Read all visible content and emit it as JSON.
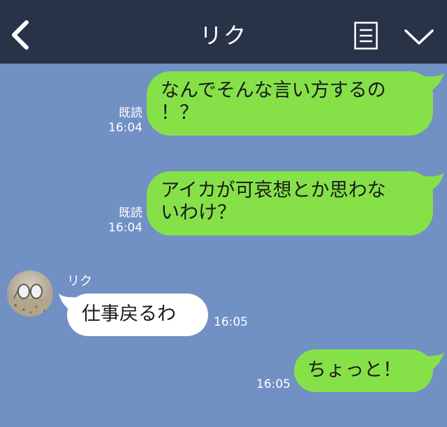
{
  "header": {
    "title": "リク",
    "back_icon": "chevron-left-icon",
    "menu_icon": "menu-list-icon",
    "dropdown_icon": "chevron-down-icon"
  },
  "colors": {
    "header_bg": "#283348",
    "chat_bg": "#7190c4",
    "outgoing_bubble": "#86e149",
    "incoming_bubble": "#ffffff"
  },
  "messages": [
    {
      "direction": "outgoing",
      "lines": [
        "なんでそんな言い方するの",
        "！？"
      ],
      "read": "既読",
      "time": "16:04"
    },
    {
      "direction": "outgoing",
      "lines": [
        "アイカが可哀想とか思わな",
        "いわけ？"
      ],
      "read": "既読",
      "time": "16:04"
    },
    {
      "direction": "incoming",
      "sender": "リク",
      "lines": [
        "仕事戻るわ"
      ],
      "time": "16:05"
    },
    {
      "direction": "outgoing",
      "lines": [
        "ちょっと！"
      ],
      "time": "16:05"
    }
  ]
}
